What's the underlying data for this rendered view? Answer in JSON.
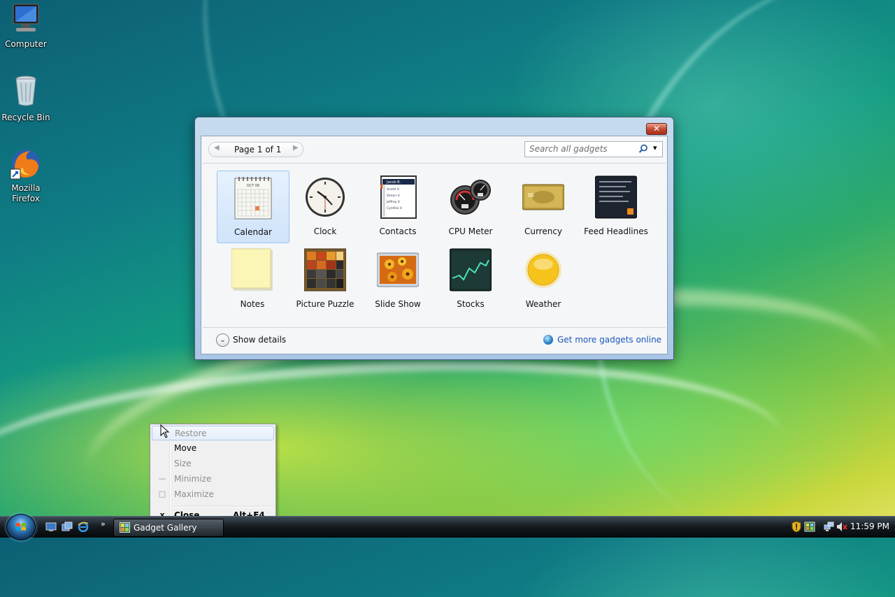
{
  "desktop": {
    "icons": [
      {
        "label": "Computer"
      },
      {
        "label": "Recycle Bin"
      },
      {
        "label": "Mozilla Firefox"
      }
    ]
  },
  "gallery": {
    "close_label": "✕",
    "pager": {
      "prev": "◀",
      "text": "Page 1 of 1",
      "next": "▶"
    },
    "search": {
      "placeholder": "Search all gadgets",
      "dropdown": "▾"
    },
    "gadgets": [
      {
        "label": "Calendar",
        "selected": true
      },
      {
        "label": "Clock"
      },
      {
        "label": "Contacts"
      },
      {
        "label": "CPU Meter"
      },
      {
        "label": "Currency"
      },
      {
        "label": "Feed Headlines"
      },
      {
        "label": "Notes"
      },
      {
        "label": "Picture Puzzle"
      },
      {
        "label": "Slide Show"
      },
      {
        "label": "Stocks"
      },
      {
        "label": "Weather"
      }
    ],
    "calendar_month": "OCT 06",
    "contacts_names": [
      "Jacob B.",
      "André V.",
      "Simon V.",
      "Jeffrey V.",
      "Cynthia V."
    ],
    "show_details": "Show details",
    "get_more": "Get more gadgets online"
  },
  "context_menu": {
    "items": [
      {
        "label": "Restore",
        "icon": "",
        "enabled": false
      },
      {
        "label": "Move",
        "icon": "",
        "enabled": true
      },
      {
        "label": "Size",
        "icon": "",
        "enabled": false
      },
      {
        "label": "Minimize",
        "icon": "—",
        "enabled": false
      },
      {
        "label": "Maximize",
        "icon": "□",
        "enabled": false
      },
      {
        "label": "Close",
        "icon": "x",
        "enabled": true,
        "shortcut": "Alt+F4"
      }
    ]
  },
  "taskbar": {
    "quick_launch_more": "»",
    "task": {
      "label": "Gadget Gallery"
    },
    "clock": "11:59 PM"
  }
}
